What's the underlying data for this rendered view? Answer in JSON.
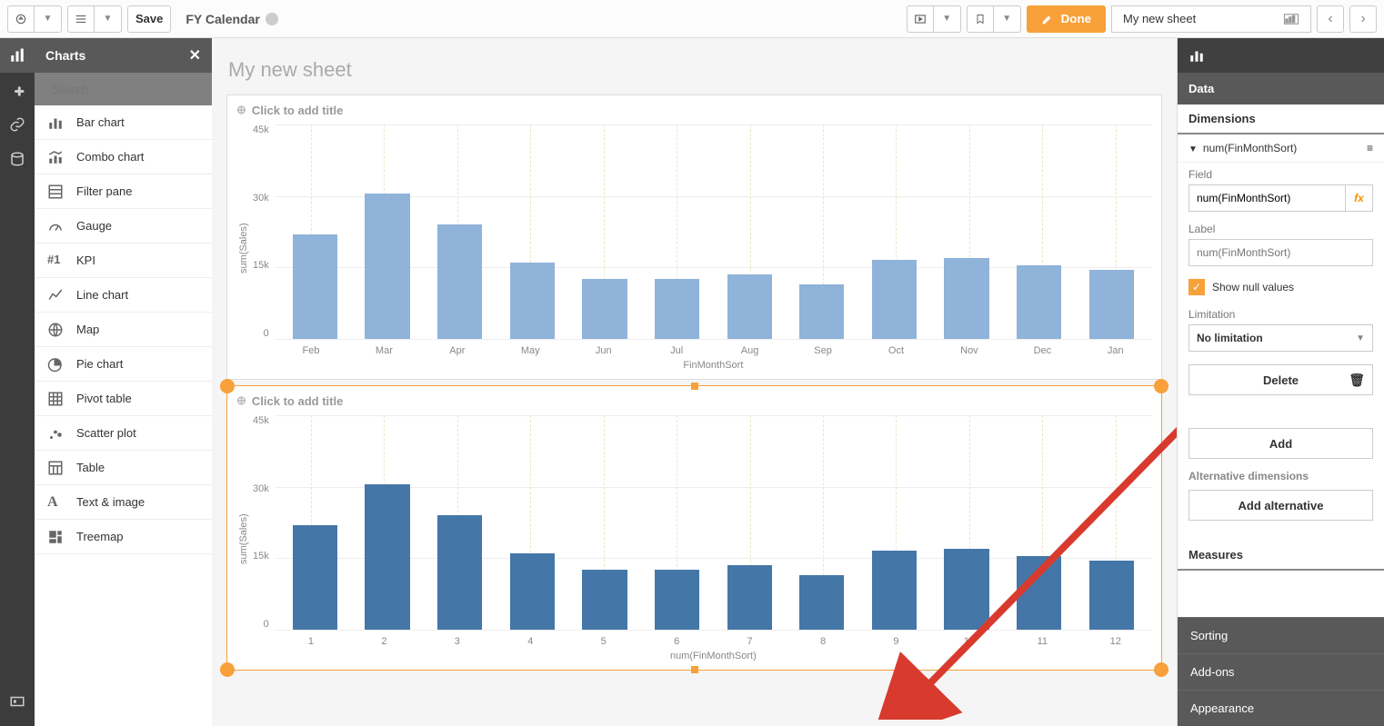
{
  "topbar": {
    "save_label": "Save",
    "app_title": "FY Calendar",
    "done_label": "Done",
    "sheet_name": "My new sheet"
  },
  "sidepanel": {
    "title": "Charts",
    "search_placeholder": "Search",
    "items": [
      {
        "label": "Bar chart"
      },
      {
        "label": "Combo chart"
      },
      {
        "label": "Filter pane"
      },
      {
        "label": "Gauge"
      },
      {
        "label": "KPI"
      },
      {
        "label": "Line chart"
      },
      {
        "label": "Map"
      },
      {
        "label": "Pie chart"
      },
      {
        "label": "Pivot table"
      },
      {
        "label": "Scatter plot"
      },
      {
        "label": "Table"
      },
      {
        "label": "Text & image"
      },
      {
        "label": "Treemap"
      }
    ]
  },
  "canvas": {
    "sheet_title": "My new sheet",
    "viz_title_placeholder": "Click to add title",
    "chart1_xlabel": "FinMonthSort",
    "chart2_xlabel": "num(FinMonthSort)",
    "ylabel": "sum(Sales)"
  },
  "props": {
    "tab_data": "Data",
    "dimensions": "Dimensions",
    "dim_name": "num(FinMonthSort)",
    "field_label": "Field",
    "field_value": "num(FinMonthSort)",
    "label_label": "Label",
    "label_placeholder": "num(FinMonthSort)",
    "show_null": "Show null values",
    "limitation_label": "Limitation",
    "limitation_value": "No limitation",
    "delete_label": "Delete",
    "add_label": "Add",
    "alt_dim_label": "Alternative dimensions",
    "add_alt_label": "Add alternative",
    "measures": "Measures",
    "sorting": "Sorting",
    "addons": "Add-ons",
    "appearance": "Appearance"
  },
  "chart_data": [
    {
      "type": "bar",
      "title": "",
      "xlabel": "FinMonthSort",
      "ylabel": "sum(Sales)",
      "ylim": [
        0,
        45000
      ],
      "yticks": [
        "45k",
        "30k",
        "15k",
        "0"
      ],
      "categories": [
        "Feb",
        "Mar",
        "Apr",
        "May",
        "Jun",
        "Jul",
        "Aug",
        "Sep",
        "Oct",
        "Nov",
        "Dec",
        "Jan"
      ],
      "values": [
        22000,
        30500,
        24000,
        16000,
        12500,
        12500,
        13500,
        11500,
        16500,
        17000,
        15500,
        14500
      ]
    },
    {
      "type": "bar",
      "title": "",
      "xlabel": "num(FinMonthSort)",
      "ylabel": "sum(Sales)",
      "ylim": [
        0,
        45000
      ],
      "yticks": [
        "45k",
        "30k",
        "15k",
        "0"
      ],
      "categories": [
        "1",
        "2",
        "3",
        "4",
        "5",
        "6",
        "7",
        "8",
        "9",
        "10",
        "11",
        "12"
      ],
      "values": [
        22000,
        30500,
        24000,
        16000,
        12500,
        12500,
        13500,
        11500,
        16500,
        17000,
        15500,
        14500
      ]
    }
  ]
}
